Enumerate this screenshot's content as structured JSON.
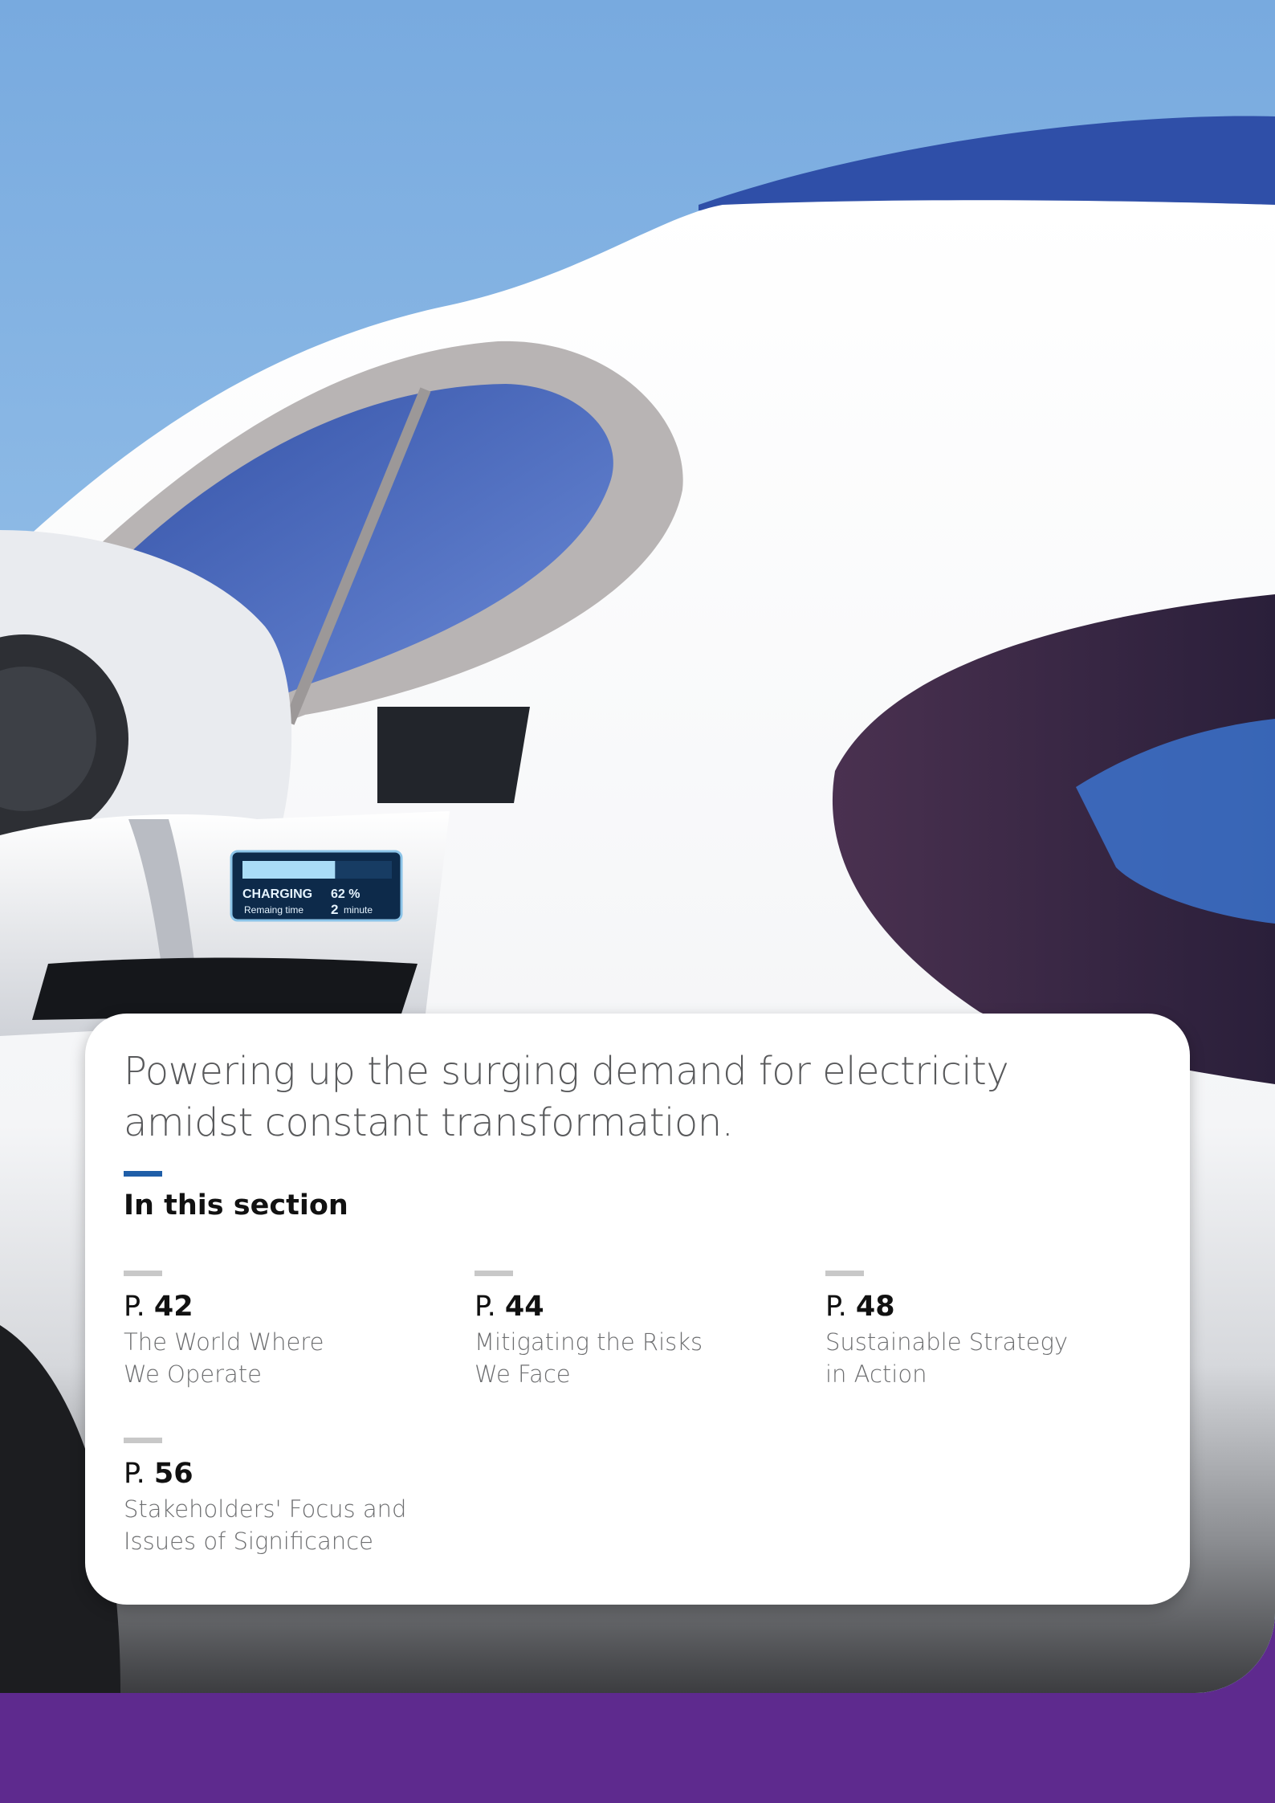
{
  "header": {
    "headline": "Powering up the surging demand for electricity amidst constant transformation."
  },
  "section": {
    "title": "In this section",
    "items": [
      {
        "prefix": "P.",
        "page": "42",
        "label_line1": "The World Where",
        "label_line2": "We Operate"
      },
      {
        "prefix": "P.",
        "page": "44",
        "label_line1": "Mitigating the Risks",
        "label_line2": "We Face"
      },
      {
        "prefix": "P.",
        "page": "48",
        "label_line1": "Sustainable Strategy",
        "label_line2": "in Action"
      },
      {
        "prefix": "P.",
        "page": "56",
        "label_line1": "Stakeholders' Focus and",
        "label_line2": "Issues of Significance"
      }
    ]
  },
  "photo": {
    "charger_display": {
      "status": "CHARGING",
      "percent": "62 %",
      "time_label": "Remaing time",
      "time_value": "2",
      "time_unit": "minute",
      "charge_level": 0.62
    }
  },
  "colors": {
    "accent_blue": "#1f5ea8",
    "band_purple": "#5e2a8e"
  }
}
